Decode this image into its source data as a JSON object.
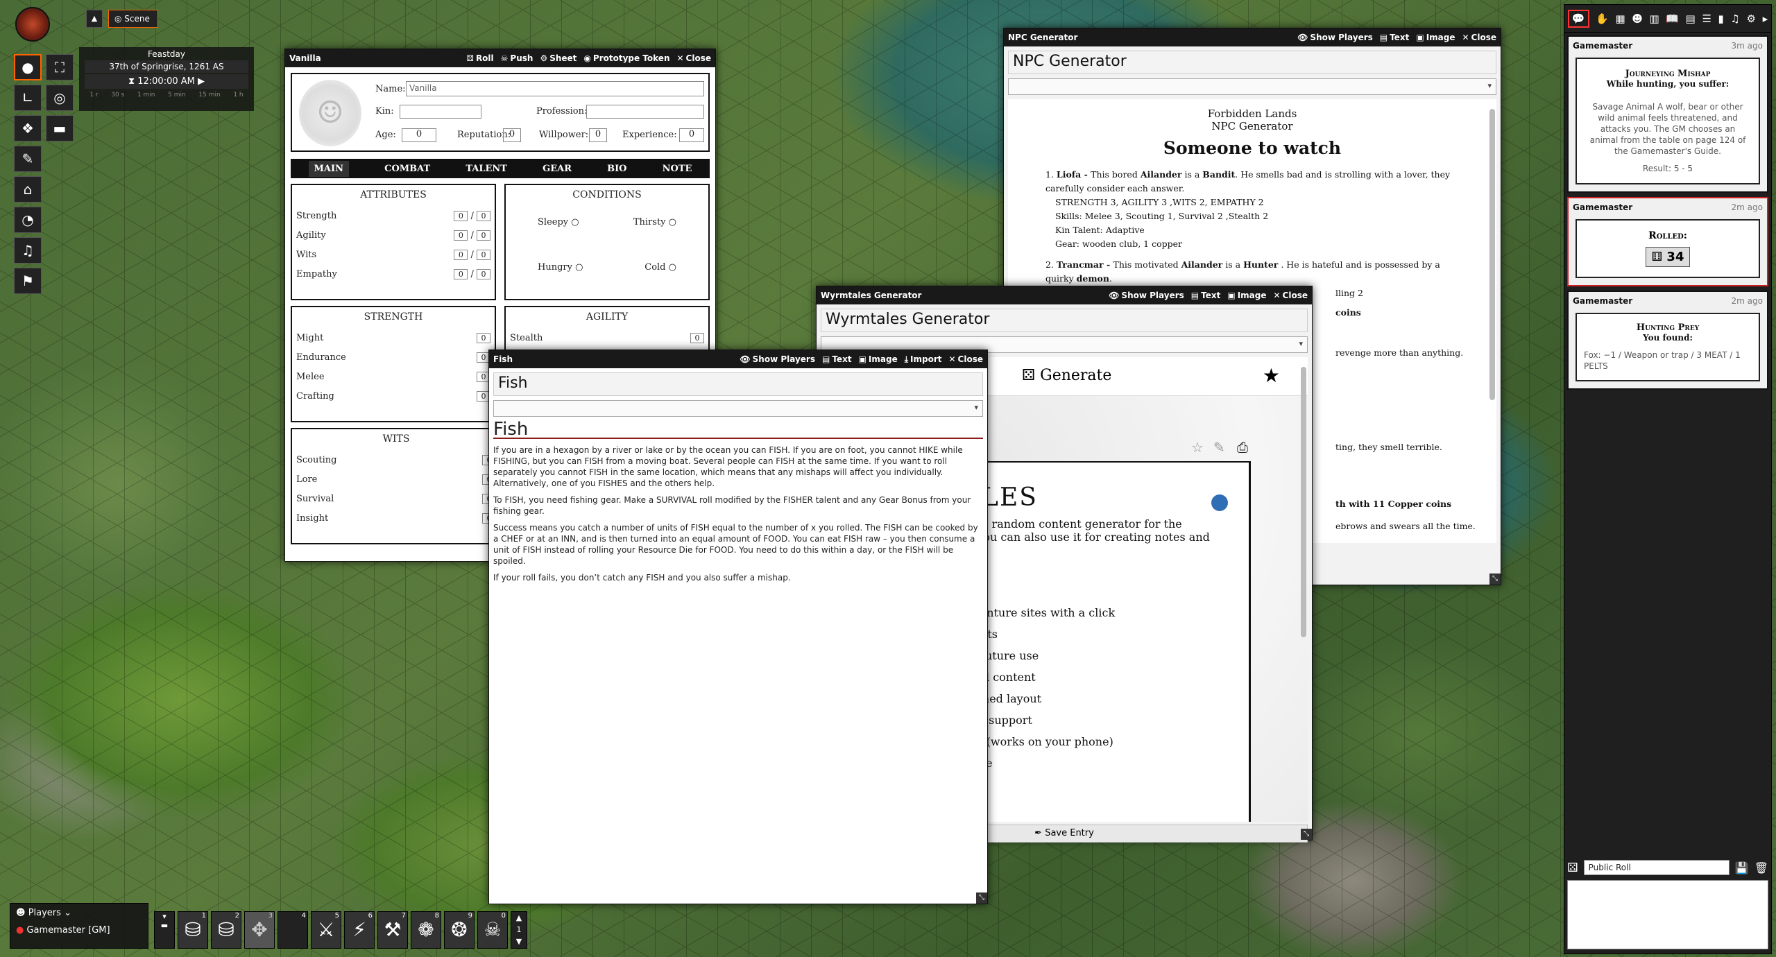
{
  "scene": {
    "label": "Scene"
  },
  "calendar": {
    "weekday": "Feastday",
    "date": "37th of Springrise, 1261 AS",
    "time": "12:00:00 AM",
    "steps": [
      "1 r",
      "30 s",
      "1 min",
      "5 min",
      "15 min",
      "1 h"
    ]
  },
  "left_tools": [
    "person-icon",
    "fullscreen-icon",
    "ruler-icon",
    "target-icon",
    "cubes-icon",
    "tape-icon",
    "pencil-icon",
    "temple-icon",
    "bulb-icon",
    "music-icon",
    "bookmark-icon"
  ],
  "sheet": {
    "title": "Vanilla",
    "buttons": [
      "Roll",
      "Push",
      "Sheet",
      "Prototype Token",
      "Close"
    ],
    "name_label": "Name:",
    "name_value": "Vanilla",
    "kin_label": "Kin:",
    "profession_label": "Profession:",
    "age_label": "Age:",
    "age_value": "0",
    "reputation_label": "Reputation:",
    "reputation_value": "0",
    "willpower_label": "Willpower:",
    "willpower_value": "0",
    "experience_label": "Experience:",
    "experience_value": "0",
    "tabs": [
      "MAIN",
      "COMBAT",
      "TALENT",
      "GEAR",
      "BIO",
      "NOTE"
    ],
    "attributes_title": "ATTRIBUTES",
    "attributes": [
      "Strength",
      "Agility",
      "Wits",
      "Empathy"
    ],
    "conditions_title": "CONDITIONS",
    "conditions": [
      "Sleepy",
      "Thirsty",
      "Hungry",
      "Cold"
    ],
    "strength_title": "STRENGTH",
    "strength_skills": [
      "Might",
      "Endurance",
      "Melee",
      "Crafting"
    ],
    "agility_title": "AGILITY",
    "agility_skill": "Stealth",
    "wits_title": "WITS",
    "wits_skills": [
      "Scouting",
      "Lore",
      "Survival",
      "Insight"
    ],
    "zero": "0"
  },
  "npc": {
    "title": "NPC Generator",
    "buttons": [
      "Show Players",
      "Text",
      "Image",
      "Close"
    ],
    "heading": "NPC Generator",
    "sub1": "Forbidden Lands",
    "sub2": "NPC Generator",
    "main_title": "Someone to watch",
    "e1_name": "Liofa - ",
    "e1_a": "This bored ",
    "e1_kin": "Ailander",
    "e1_b": " is a ",
    "e1_prof": "Bandit",
    ". ": "",
    "e1_c": ". He smells bad and is strolling with a lover, they carefully consider each answer.",
    "e1_stats": "STRENGTH 3, AGILITY 3 ,WITS 2, EMPATHY 2",
    "e1_skills": "Skills: Melee 3, Scouting 1, Survival 2 ,Stealth 2",
    "e1_talent": "Kin Talent: Adaptive",
    "e1_gear": "Gear: wooden club, 1 copper",
    "e2_name": "Trancmar - ",
    "e2_a": "This motivated ",
    "e2_kin": "Ailander",
    "e2_b": " is a ",
    "e2_prof": "Hunter",
    "e2_c": " . He is hateful and is possessed by a quirky ",
    "e2_d": "demon",
    "frag1": "lling 2",
    "frag2": "coins",
    "frag3": "revenge more than anything.",
    "frag4": "ting, they smell terrible.",
    "frag5": "th with 11 Copper coins",
    "frag6": "ebrows and swears all the time."
  },
  "wyrm": {
    "title": "Wyrmtales Generator",
    "buttons": [
      "Show Players",
      "Text",
      "Image",
      "Close"
    ],
    "heading": "Wyrmtales Generator",
    "generate": "Generate",
    "brand": "TALES",
    "intro1": "Tales, a random content generator for the",
    "intro2": "RPG. You can also use it for creating notes and",
    "features": [
      "te adventure sites with a click",
      "handouts",
      "es for future use",
      "nerated content",
      "th themed layout",
      "wedish support",
      "design (works on your phone)",
      "it offline"
    ],
    "save": "Save Entry"
  },
  "fish": {
    "title": "Fish",
    "buttons": [
      "Show Players",
      "Text",
      "Image",
      "Import",
      "Close"
    ],
    "heading": "Fish",
    "subheading": "Fish",
    "p1": "If you are in a hexagon by a river or lake or by the ocean you can FISH. If you are on foot, you cannot HIKE while FISHING, but you can FISH from a moving boat. Several people can FISH at the same time. If you want to roll separately you cannot FISH in the same location, which means that any mishaps will affect you individually. Alternatively, one of you FISHES and the others help.",
    "p2": "To FISH, you need fishing gear. Make a SURVIVAL roll modified by the FISHER talent and any Gear Bonus from your fishing gear.",
    "p3": "Success means you catch a number of units of FISH equal to the number of x you rolled. The FISH can be cooked by a CHEF or at an INN, and is then turned into an equal amount of FOOD. You can eat FISH raw – you then consume a unit of FISH instead of rolling your Resource Die for FOOD. You need to do this within a day, or the FISH will be spoiled.",
    "p4": "If your roll fails, you don’t catch any FISH and you also suffer a mishap."
  },
  "chat": {
    "tabs": [
      "chat-icon",
      "hand-icon",
      "map-icon",
      "users-icon",
      "book-icon",
      "journal-icon",
      "cards-icon",
      "playlist-icon",
      "compendium-icon",
      "music-icon",
      "settings-icon",
      "arrow-icon"
    ],
    "messages": [
      {
        "author": "Gamemaster",
        "time": "3m ago",
        "title": "Journeying Mishap",
        "subtitle": "While hunting, you suffer:",
        "body": "Savage Animal A wolf, bear or other wild animal feels threatened, and attacks you. The GM chooses an animal from the table on page 124 of the Gamemaster's Guide.",
        "result": "Result: 5 - 5"
      },
      {
        "author": "Gamemaster",
        "time": "2m ago",
        "title": "Rolled:",
        "dice": "34"
      },
      {
        "author": "Gamemaster",
        "time": "2m ago",
        "title": "Hunting Prey",
        "subtitle": "You found:",
        "body": "Fox: −1 / Weapon or trap / 3 MEAT / 1 PELTS"
      }
    ],
    "roll_mode": "Public Roll"
  },
  "players": {
    "label": "Players",
    "user": "Gamemaster [GM]"
  },
  "hotbar": {
    "slots": [
      "1",
      "2",
      "3",
      "4",
      "5",
      "6",
      "7",
      "8",
      "9",
      "0"
    ],
    "page": "1"
  }
}
